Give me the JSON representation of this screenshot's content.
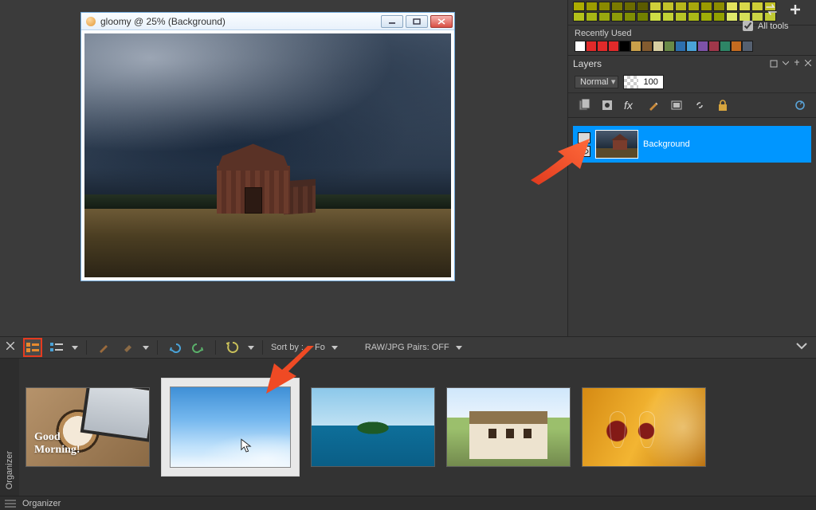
{
  "document": {
    "title": "gloomy @  25% (Background)"
  },
  "palette": {
    "all_tools_label": "All tools",
    "recent_title": "Recently Used",
    "row1": [
      "#adad00",
      "#9c9c00",
      "#8a8a00",
      "#7a7a00",
      "#6b6b00",
      "#5b5b00",
      "#cfcf3a",
      "#c2c22a",
      "#b5b51b",
      "#a8a80c",
      "#9b9b00",
      "#8d8d00",
      "#e3e35d",
      "#d7d74a",
      "#cccc37",
      "#c0c025"
    ],
    "row2": [
      "#b3c21a",
      "#a6b515",
      "#99a80f",
      "#8c9b09",
      "#7f8e04",
      "#728100",
      "#cedd45",
      "#c2d135",
      "#b6c526",
      "#aab917",
      "#9ead08",
      "#92a000",
      "#e0ea6a",
      "#d5df57",
      "#cad445",
      "#bfc933"
    ],
    "recent": [
      "#ffffff",
      "#e02a2a",
      "#e02a2a",
      "#e02a2a",
      "#000000",
      "#c9a04a",
      "#835b2f",
      "#d8cfa2",
      "#6a8a48",
      "#2d6fae",
      "#4aa3d8",
      "#7d52a8",
      "#a0374a",
      "#2e8566",
      "#c46b20",
      "#556070"
    ]
  },
  "layers": {
    "title": "Layers",
    "blend_mode": "Normal",
    "opacity": "100",
    "entries": [
      {
        "name": "Background"
      }
    ]
  },
  "organizer": {
    "sort_label": "Sort by :",
    "sort_value": "Fo",
    "raw_label": "RAW/JPG Pairs: OFF",
    "side_label": "Organizer",
    "status_label": "Organizer",
    "thumb_caption_0": "Good\nMorning!"
  }
}
